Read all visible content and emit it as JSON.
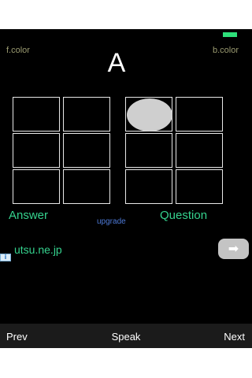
{
  "status_colors": {
    "indicator": "#2ee07a",
    "accent": "#35d28e",
    "link": "#4d79d6"
  },
  "header": {
    "fcolor_label": "f.color",
    "bcolor_label": "b.color",
    "letter": "A"
  },
  "braille": {
    "left_cell_dots": [
      false,
      false,
      false,
      false,
      false,
      false
    ],
    "right_cell_dots": [
      true,
      false,
      false,
      false,
      false,
      false
    ]
  },
  "labels": {
    "answer": "Answer",
    "question": "Question",
    "upgrade": "upgrade"
  },
  "ad": {
    "text": "utsu.ne.jp",
    "info_icon": "info-icon",
    "arrow_icon": "arrow-right-icon",
    "arrow_glyph": "➡"
  },
  "bottom_bar": {
    "prev_label": "Prev",
    "speak_label": "Speak",
    "next_label": "Next"
  }
}
